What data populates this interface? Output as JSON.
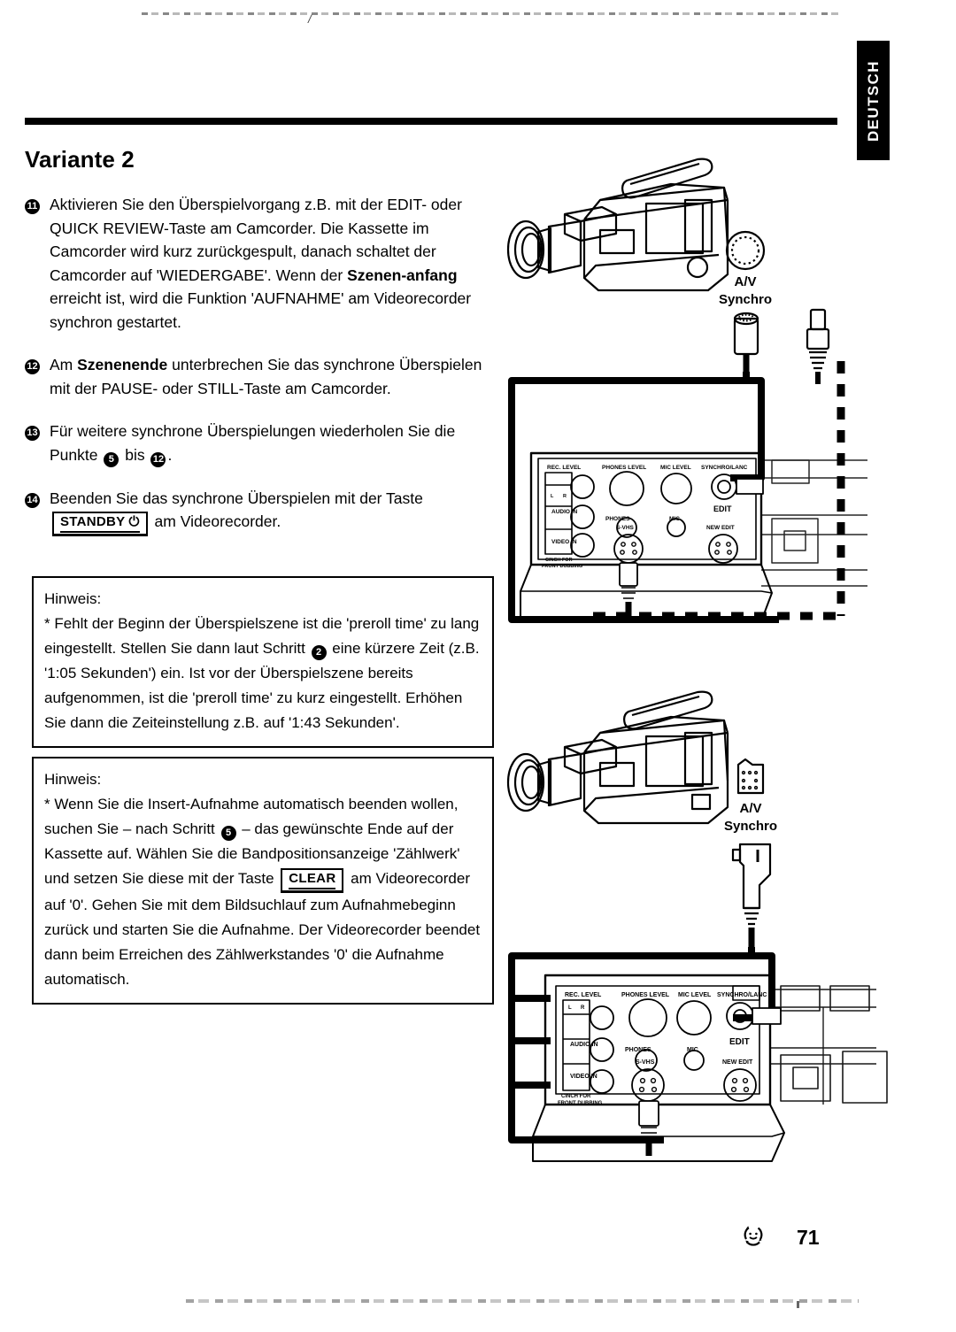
{
  "language_tab": {
    "label": "DEUTSCH"
  },
  "page": {
    "title": "Variante 2",
    "number": "71",
    "recycle_icon": "smiley-recycle-icon"
  },
  "steps": [
    {
      "number": "11",
      "html_id": "step-11",
      "lines": [
        "Aktivieren Sie den Überspielvorgang z.B. mit der EDIT-",
        "oder QUICK REVIEW-Taste am Camcorder. Die Kassette",
        "im Camcorder wird kurz zurückgespult, danach schaltet",
        "der Camcorder auf 'WIEDERGABE'. Wenn der ",
        "anfang erreicht ist, wird die Funktion 'AUFNAHME' am",
        "Videorecorder synchron gestartet."
      ],
      "bold_1": "Szenen-",
      "bold_2": "anfang",
      "text_part_1": "Aktivieren Sie den Überspielvorgang z.B. mit der EDIT- oder QUICK REVIEW-Taste am Camcorder. Die Kassette im Camcorder wird kurz zurückgespult, danach schaltet der Camcorder auf 'WIEDERGABE'. Wenn der ",
      "text_part_2": " erreicht ist, wird die Funktion 'AUFNAHME' am Videorecorder synchron gestartet."
    },
    {
      "number": "12",
      "html_id": "step-12",
      "text_part_1": "Am ",
      "bold_1": "Szenenende",
      "text_part_2": " unterbrechen Sie das synchrone Überspielen mit der PAUSE- oder STILL-Taste am Camcorder."
    },
    {
      "number": "13",
      "html_id": "step-13",
      "text_part_1": "Für weitere synchrone Überspielungen wiederholen Sie die Punkte ",
      "ref_a": "5",
      "text_part_2": " bis ",
      "ref_b": "12",
      "text_part_3": "."
    },
    {
      "number": "14",
      "html_id": "step-14",
      "text_part_1": "Beenden Sie das synchrone Überspielen mit der Taste ",
      "keycap": "STANDBY",
      "keycap_icon": "power-standby-icon",
      "text_part_2": " am Videorecorder."
    }
  ],
  "notes": [
    {
      "heading": "Hinweis:",
      "text_part_1": "* Fehlt der Beginn der Überspielszene ist die 'preroll time' zu lang eingestellt. Stellen Sie dann laut Schritt ",
      "ref": "2",
      "text_part_2": " eine kürzere Zeit (z.B. '1:05 Sekunden') ein. Ist vor der Überspielszene bereits aufgenommen, ist die 'preroll time' zu kurz eingestellt. Erhöhen Sie dann die Zeiteinstellung z.B. auf '1:43 Sekunden'."
    },
    {
      "heading": "Hinweis:",
      "text_part_1": "* Wenn Sie die Insert-Aufnahme automatisch beenden wollen, suchen Sie – nach Schritt ",
      "ref": "5",
      "text_part_2": " – das gewünschte Ende auf der Kassette auf. Wählen Sie die Bandpositionsanzeige 'Zählwerk' und setzen Sie diese mit der Taste ",
      "keycap": "CLEAR",
      "text_part_3": " am Videorecorder auf '0'. Gehen Sie mit dem Bildsuchlauf zum Aufnahmebeginn zurück und starten Sie die Aufnahme. Der Videorecorder beendet dann beim Erreichen des Zählwerkstandes '0' die Aufnahme automatisch."
    }
  ],
  "figures": [
    {
      "id": "figure-top",
      "camcorder_label": "camcorder-illustration",
      "port_label_line1": "A/V",
      "port_label_line2": "Synchro",
      "connector_type": "round-din-plug",
      "vcr_panel": {
        "labels": {
          "rec_level": "REC. LEVEL",
          "phones_level": "PHONES LEVEL",
          "mic_level": "MIC LEVEL",
          "synchro_lanc": "SYNCHRO/LANC",
          "audio_in": "AUDIO IN",
          "video_in": "VIDEO IN",
          "phones": "PHONES",
          "mic": "MIC",
          "edit": "EDIT",
          "s_vhs": "S-VHS",
          "new_edit": "NEW EDIT",
          "cinch_top": "CINCH  FOR",
          "cinch_bottom": "FRONT     DUBBING",
          "level_l": "L",
          "level_r": "R"
        }
      }
    },
    {
      "id": "figure-bottom",
      "camcorder_label": "camcorder-illustration",
      "port_label_line1": "A/V",
      "port_label_line2": "Synchro",
      "connector_type": "rectangular-lanc-plug",
      "vcr_panel": {
        "labels": {
          "rec_level": "REC. LEVEL",
          "phones_level": "PHONES LEVEL",
          "mic_level": "MIC LEVEL",
          "synchro_lanc": "SYNCHRO/LANC",
          "audio_in": "AUDIO IN",
          "video_in": "VIDEO IN",
          "phones": "PHONES",
          "mic": "MIC",
          "edit": "EDIT",
          "s_vhs": "S-VHS",
          "new_edit": "NEW EDIT",
          "cinch_top": "CINCH  FOR",
          "cinch_bottom": "FRONT     DUBBING",
          "level_l": "L",
          "level_r": "R"
        }
      }
    }
  ]
}
